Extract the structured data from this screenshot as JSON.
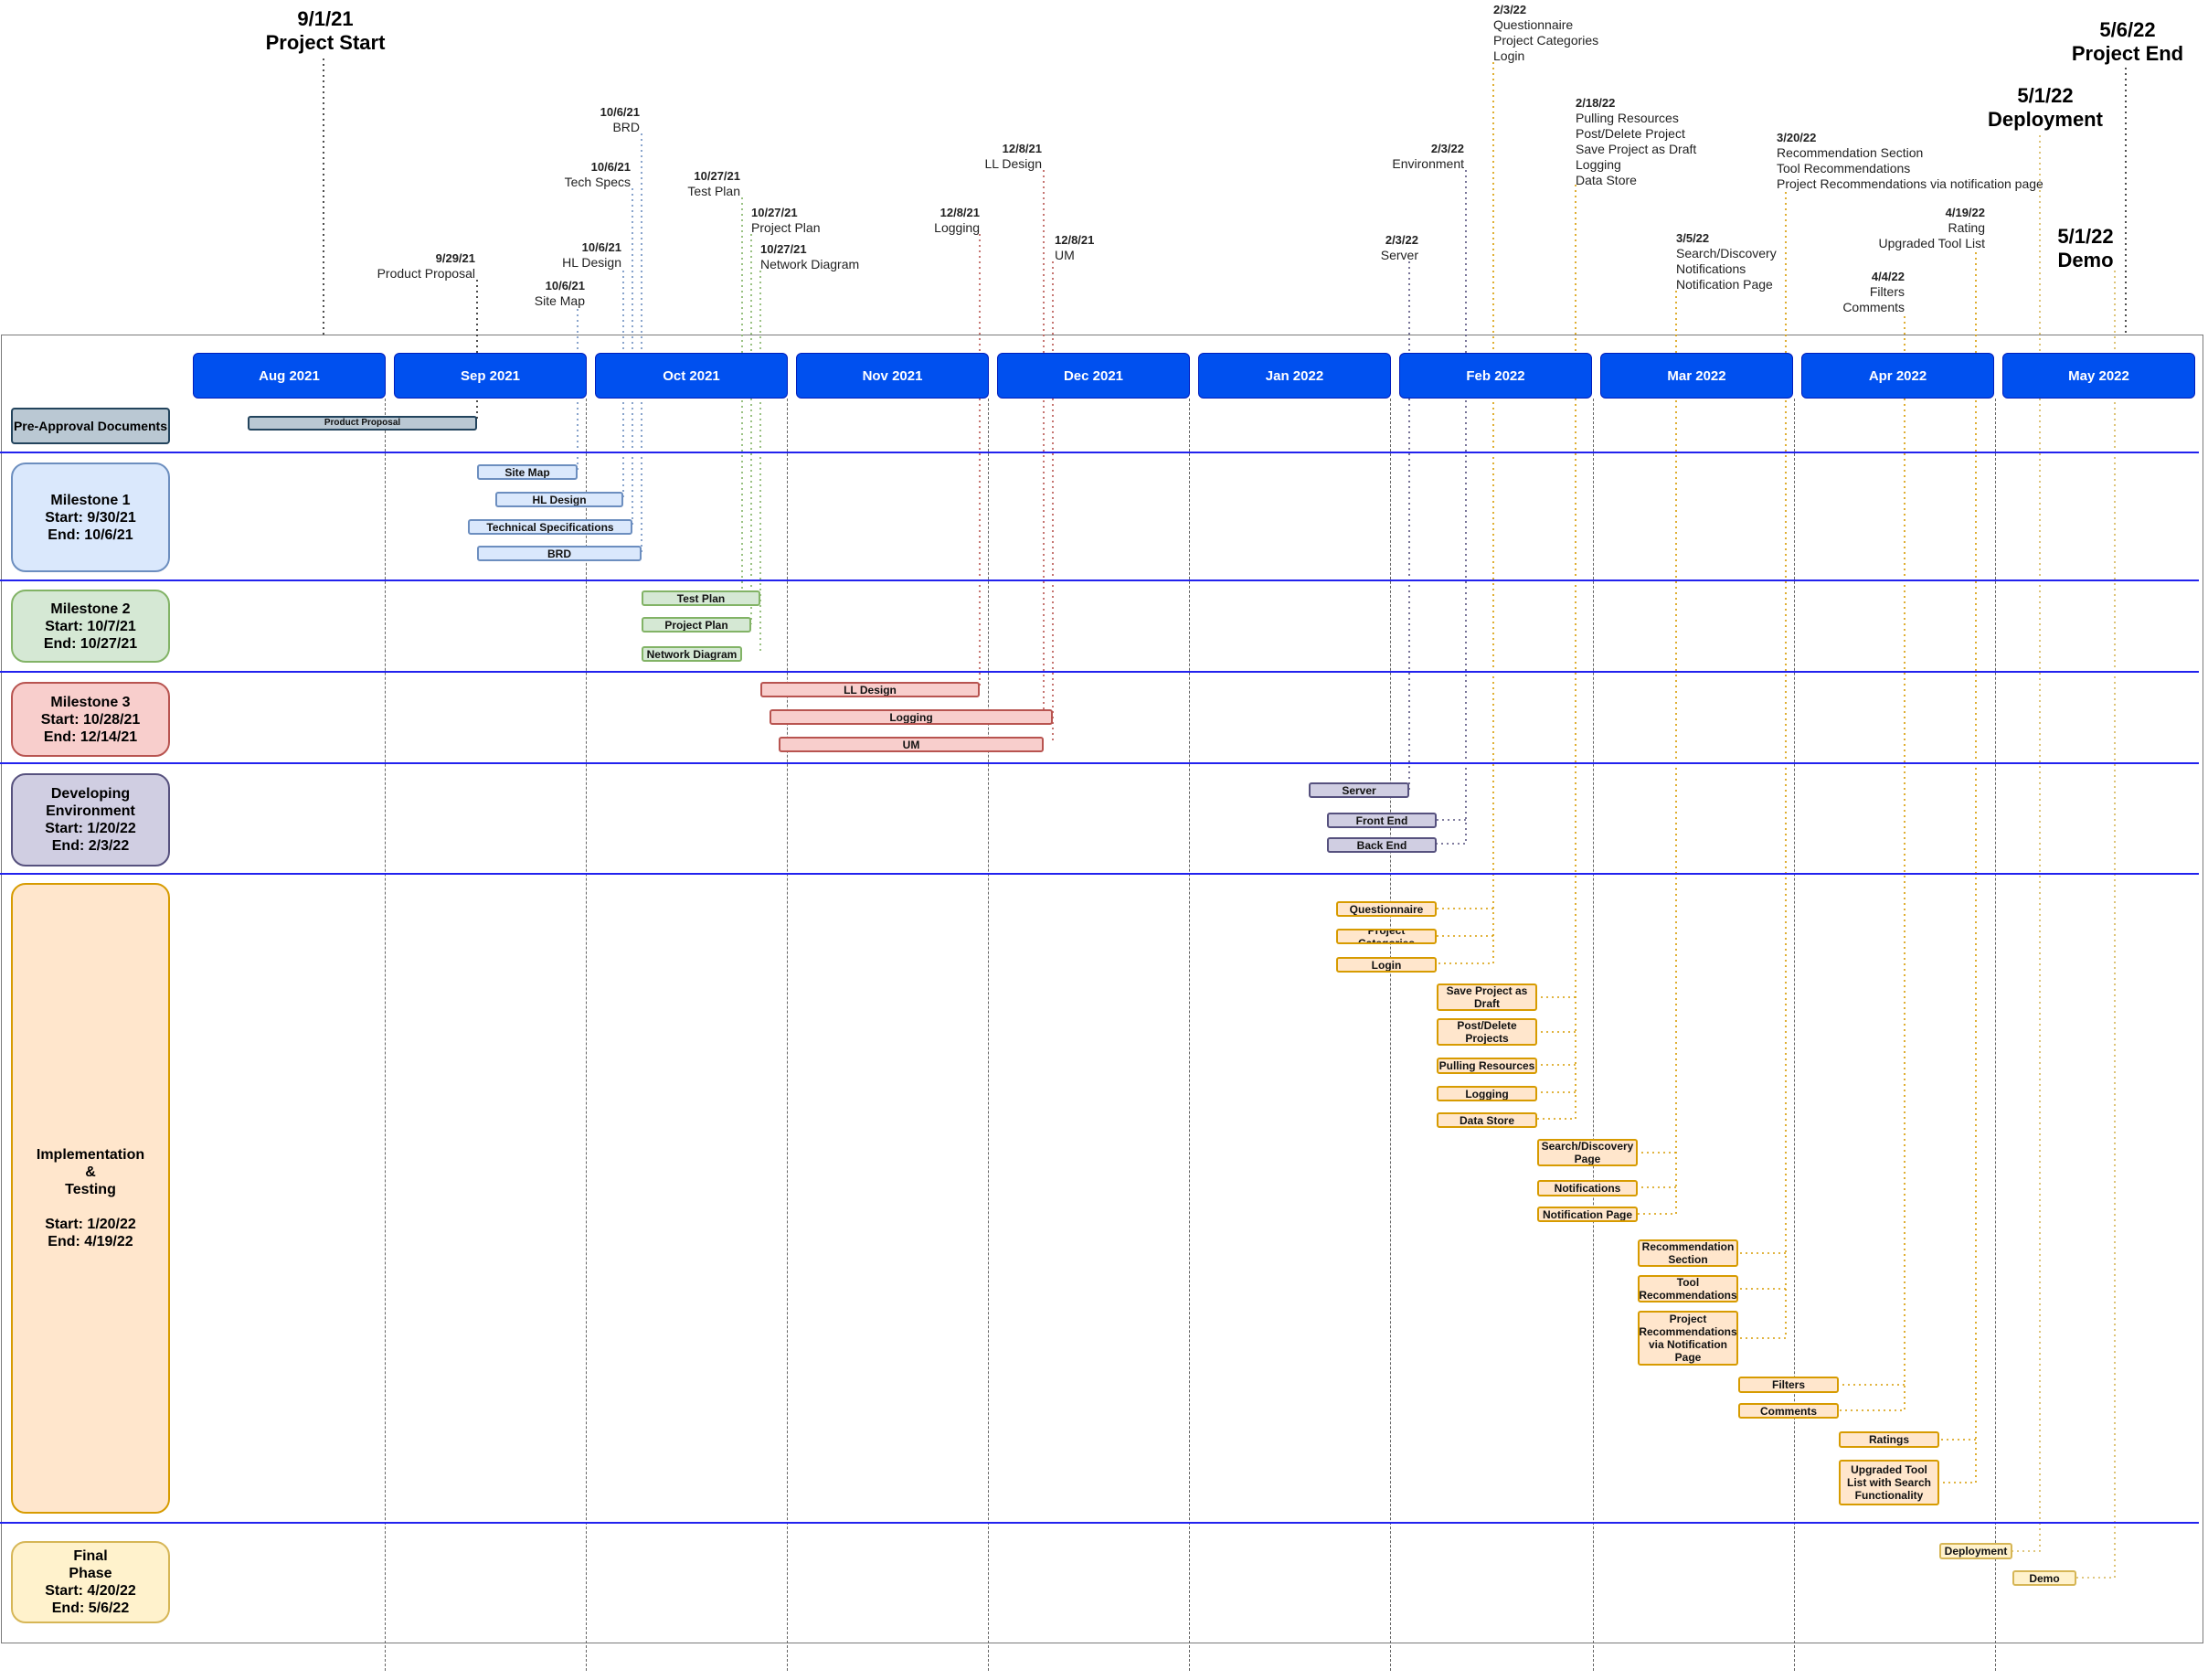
{
  "months": [
    "Aug 2021",
    "Sep 2021",
    "Oct 2021",
    "Nov 2021",
    "Dec 2021",
    "Jan 2022",
    "Feb 2022",
    "Mar 2022",
    "Apr 2022",
    "May 2022"
  ],
  "milestones_big": [
    {
      "date": "9/1/21",
      "label": "Project Start"
    },
    {
      "date": "5/6/22",
      "label": "Project End"
    },
    {
      "date": "5/1/22",
      "label": "Deployment"
    },
    {
      "date": "5/1/22",
      "label": "Demo"
    }
  ],
  "phases": [
    {
      "label": "Pre-Approval Documents"
    },
    {
      "label": "Milestone 1\nStart: 9/30/21\nEnd: 10/6/21"
    },
    {
      "label": "Milestone 2\nStart: 10/7/21\nEnd: 10/27/21"
    },
    {
      "label": "Milestone 3\nStart: 10/28/21\nEnd: 12/14/21"
    },
    {
      "label": "Developing\nEnvironment\nStart: 1/20/22\nEnd: 2/3/22"
    },
    {
      "label": "Implementation\n&\nTesting\n\nStart: 1/20/22\nEnd: 4/19/22"
    },
    {
      "label": "Final\nPhase\nStart: 4/20/22\nEnd: 5/6/22"
    }
  ],
  "tasks": [
    "Product Proposal",
    "Site Map",
    "HL Design",
    "Technical Specifications",
    "BRD",
    "Test Plan",
    "Project Plan",
    "Network Diagram",
    "LL Design",
    "Logging",
    "UM",
    "Server",
    "Front End",
    "Back End",
    "Questionnaire",
    "Project Categories",
    "Login",
    "Save Project as\nDraft",
    "Post/Delete\nProjects",
    "Pulling Resources",
    "Logging",
    "Data Store",
    "Search/Discovery\nPage",
    "Notifications",
    "Notification Page",
    "Recommendation\nSection",
    "Tool\nRecommendations",
    "Project\nRecommendations\nvia Notification\nPage",
    "Filters",
    "Comments",
    "Ratings",
    "Upgraded Tool\nList with Search\nFunctionality",
    "Deployment",
    "Demo"
  ],
  "annotations": [
    {
      "date": "9/29/21",
      "lines": [
        "Product Proposal"
      ]
    },
    {
      "date": "10/6/21",
      "lines": [
        "Site Map"
      ]
    },
    {
      "date": "10/6/21",
      "lines": [
        "HL Design"
      ]
    },
    {
      "date": "10/6/21",
      "lines": [
        "Tech Specs"
      ]
    },
    {
      "date": "10/6/21",
      "lines": [
        "BRD"
      ]
    },
    {
      "date": "10/27/21",
      "lines": [
        "Test Plan"
      ]
    },
    {
      "date": "10/27/21",
      "lines": [
        "Project Plan"
      ]
    },
    {
      "date": "10/27/21",
      "lines": [
        "Network Diagram"
      ]
    },
    {
      "date": "12/8/21",
      "lines": [
        "LL Design"
      ]
    },
    {
      "date": "12/8/21",
      "lines": [
        "Logging"
      ]
    },
    {
      "date": "12/8/21",
      "lines": [
        "UM"
      ]
    },
    {
      "date": "2/3/22",
      "lines": [
        "Server"
      ]
    },
    {
      "date": "2/3/22",
      "lines": [
        "Environment"
      ]
    },
    {
      "date": "2/3/22",
      "lines": [
        "Questionnaire",
        "Project Categories",
        "Login"
      ]
    },
    {
      "date": "2/18/22",
      "lines": [
        "Pulling Resources",
        "Post/Delete Project",
        "Save Project as Draft",
        "Logging",
        "Data Store"
      ]
    },
    {
      "date": "3/5/22",
      "lines": [
        "Search/Discovery",
        "Notifications",
        "Notification Page"
      ]
    },
    {
      "date": "3/20/22",
      "lines": [
        "Recommendation Section",
        "Tool Recommendations",
        "Project Recommendations via notification page"
      ]
    },
    {
      "date": "4/4/22",
      "lines": [
        "Filters",
        "Comments"
      ]
    },
    {
      "date": "4/19/22",
      "lines": [
        "Rating",
        "Upgraded Tool List"
      ]
    }
  ],
  "colors": {
    "month_fill": "#0050ef",
    "month_border": "#001dbc",
    "separator": "#2222ee",
    "gray_fill": "#bac8d3",
    "gray_border": "#23445d",
    "blue_fill": "#dae8fc",
    "blue_border": "#6c8ebf",
    "green_fill": "#d5e8d4",
    "green_border": "#82b366",
    "red_fill": "#f8cecc",
    "red_border": "#b85450",
    "purple_fill": "#d0cee2",
    "purple_border": "#56517e",
    "orange_fill": "#ffe6cc",
    "orange_border": "#d79b00",
    "yellow_fill": "#fff2cc",
    "yellow_border": "#d6b656"
  }
}
